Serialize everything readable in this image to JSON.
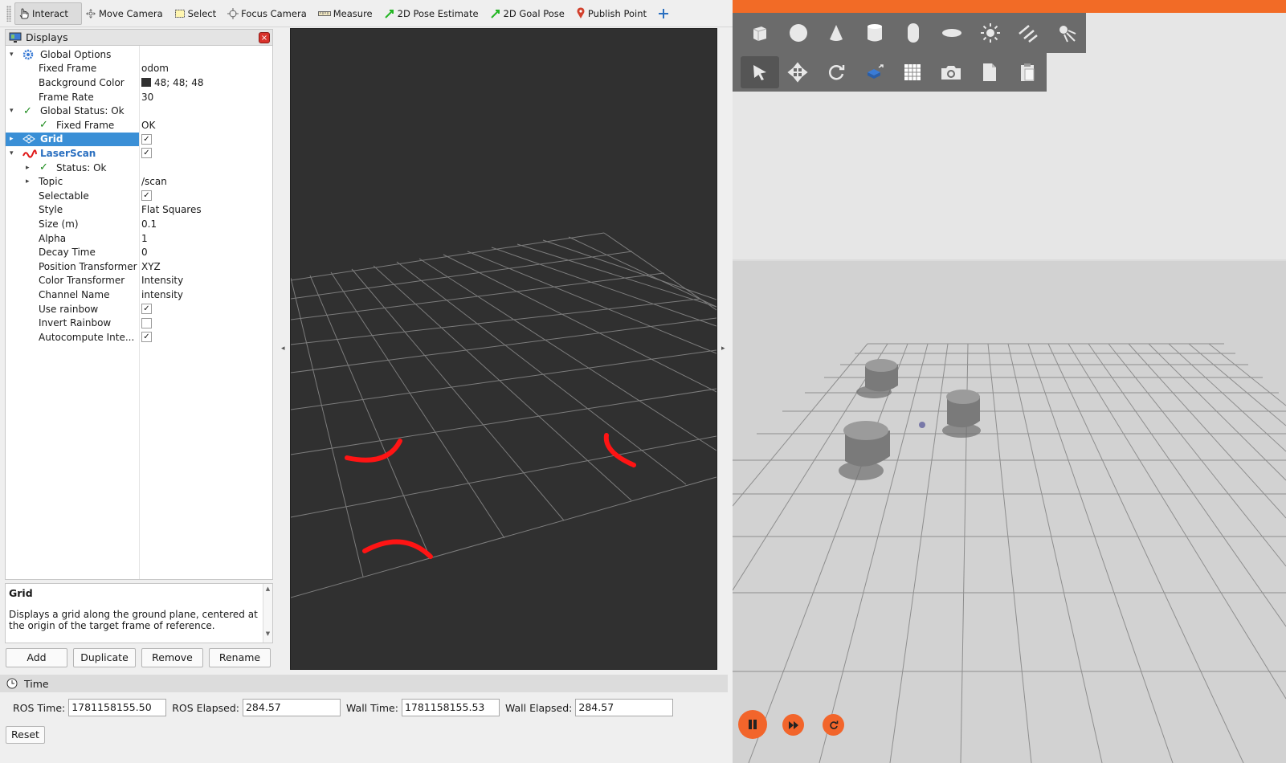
{
  "toolbar": {
    "tools": [
      {
        "label": "Interact",
        "icon": "hand-cursor-icon",
        "active": true
      },
      {
        "label": "Move Camera",
        "icon": "move-camera-icon"
      },
      {
        "label": "Select",
        "icon": "select-box-icon"
      },
      {
        "label": "Focus Camera",
        "icon": "focus-crosshair-icon"
      },
      {
        "label": "Measure",
        "icon": "ruler-icon"
      },
      {
        "label": "2D Pose Estimate",
        "icon": "green-arrow-icon"
      },
      {
        "label": "2D Goal Pose",
        "icon": "green-arrow-icon"
      },
      {
        "label": "Publish Point",
        "icon": "map-pin-icon"
      }
    ],
    "add_tool_icon": "plus-icon"
  },
  "displays": {
    "title": "Displays",
    "rows": [
      {
        "label": "Global Options",
        "value": ""
      },
      {
        "label": "Fixed Frame",
        "value": "odom"
      },
      {
        "label": "Background Color",
        "value": "48; 48; 48"
      },
      {
        "label": "Frame Rate",
        "value": "30"
      },
      {
        "label": "Global Status: Ok",
        "value": ""
      },
      {
        "label": "Fixed Frame",
        "value": "OK"
      },
      {
        "label": "Grid",
        "value": "",
        "checked": true
      },
      {
        "label": "LaserScan",
        "value": "",
        "checked": true
      },
      {
        "label": "Status: Ok",
        "value": ""
      },
      {
        "label": "Topic",
        "value": "/scan"
      },
      {
        "label": "Selectable",
        "value": "",
        "checked": true
      },
      {
        "label": "Style",
        "value": "Flat Squares"
      },
      {
        "label": "Size (m)",
        "value": "0.1"
      },
      {
        "label": "Alpha",
        "value": "1"
      },
      {
        "label": "Decay Time",
        "value": "0"
      },
      {
        "label": "Position Transformer",
        "value": "XYZ"
      },
      {
        "label": "Color Transformer",
        "value": "Intensity"
      },
      {
        "label": "Channel Name",
        "value": "intensity"
      },
      {
        "label": "Use rainbow",
        "value": "",
        "checked": true
      },
      {
        "label": "Invert Rainbow",
        "value": "",
        "checked": false
      },
      {
        "label": "Autocompute Inte...",
        "value": "",
        "checked": true
      }
    ]
  },
  "description": {
    "title": "Grid",
    "text": "Displays a grid along the ground plane, centered at the origin of the target frame of reference."
  },
  "buttons": {
    "add": "Add",
    "duplicate": "Duplicate",
    "remove": "Remove",
    "rename": "Rename"
  },
  "time": {
    "title": "Time",
    "ros_time_label": "ROS Time:",
    "ros_time": "1781158155.50",
    "ros_elapsed_label": "ROS Elapsed:",
    "ros_elapsed": "284.57",
    "wall_time_label": "Wall Time:",
    "wall_time": "1781158155.53",
    "wall_elapsed_label": "Wall Elapsed:",
    "wall_elapsed": "284.57",
    "reset": "Reset"
  },
  "viewport": {
    "background": "#303030",
    "scan_color": "#ff0000"
  },
  "gazebo": {
    "accent": "#f26b26",
    "shape_tools": [
      "box-icon",
      "sphere-icon",
      "cone-icon",
      "cylinder-icon",
      "capsule-icon",
      "ellipsoid-icon",
      "sun-light-icon",
      "directional-light-icon",
      "spot-light-icon"
    ],
    "transform_tools": [
      "select-arrow-icon",
      "translate-icon",
      "rotate-icon",
      "scale-icon",
      "grid-snap-icon",
      "camera-icon",
      "copy-icon",
      "paste-icon"
    ],
    "playback": [
      "pause-icon",
      "step-forward-icon",
      "reset-icon"
    ]
  }
}
